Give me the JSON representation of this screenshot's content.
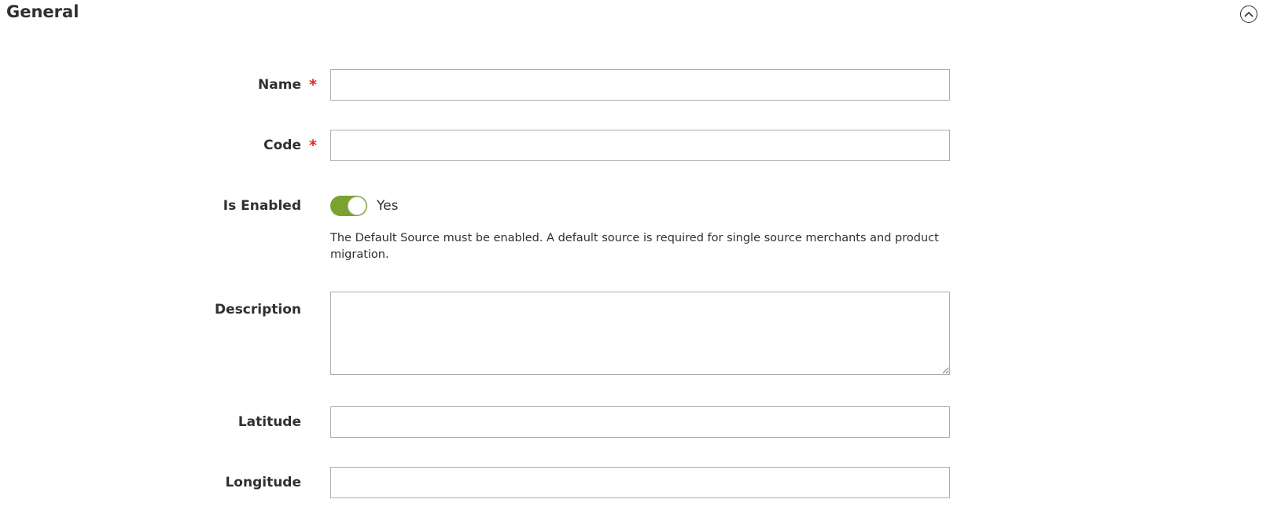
{
  "section": {
    "title": "General",
    "collapse_icon": "chevron-up-circle-icon"
  },
  "fields": {
    "name": {
      "label": "Name",
      "required_mark": "*",
      "value": ""
    },
    "code": {
      "label": "Code",
      "required_mark": "*",
      "value": ""
    },
    "is_enabled": {
      "label": "Is Enabled",
      "toggle_state": "on",
      "toggle_text": "Yes",
      "note": "The Default Source must be enabled. A default source is required for single source merchants and product migration."
    },
    "description": {
      "label": "Description",
      "value": ""
    },
    "latitude": {
      "label": "Latitude",
      "value": ""
    },
    "longitude": {
      "label": "Longitude",
      "value": ""
    }
  },
  "colors": {
    "required": "#e22626",
    "toggle_on": "#79a22e",
    "text": "#303030",
    "input_border": "#adadad"
  }
}
